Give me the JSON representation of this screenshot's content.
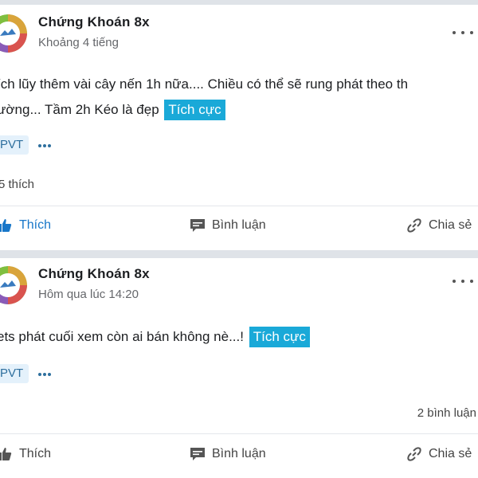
{
  "colors": {
    "accent": "#1aa9d8",
    "like_blue": "#1877c9",
    "ticker_bg": "#e4f1fb"
  },
  "posts": [
    {
      "author": "Chứng Khoán 8x",
      "time": "Khoảng 4 tiếng",
      "content_line1": "ích lũy thêm vài cây nến 1h nữa.... Chiều có thể sẽ rung phát theo th",
      "content_line2": "ường... Tầm 2h Kéo là đẹp",
      "sentiment": "Tích cực",
      "ticker": "PVT",
      "likes": "5 thích",
      "comments": "",
      "actions": {
        "like": "Thích",
        "comment": "Bình luận",
        "share": "Chia sẻ"
      }
    },
    {
      "author": "Chứng Khoán 8x",
      "time": "Hôm qua lúc 14:20",
      "content_line1": "ets phát cuối xem còn ai bán không nè...!",
      "content_line2": "",
      "sentiment": "Tích cực",
      "ticker": "PVT",
      "likes": "",
      "comments": "2 bình luận",
      "actions": {
        "like": "Thích",
        "comment": "Bình luận",
        "share": "Chia sẻ"
      }
    }
  ],
  "icons": {
    "more": "more-horizontal-icon",
    "like": "thumbs-up-icon",
    "comment": "comment-icon",
    "share": "link-share-icon"
  }
}
